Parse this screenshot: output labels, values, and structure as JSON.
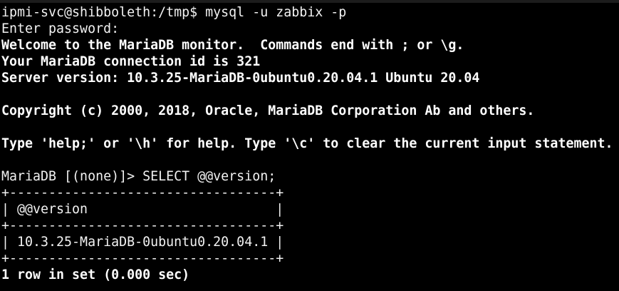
{
  "terminal": {
    "lines": [
      {
        "text": "ipmi-svc@shibboleth:/tmp$ mysql -u zabbix -p",
        "weight": "normal"
      },
      {
        "text": "Enter password:",
        "weight": "normal"
      },
      {
        "text": "Welcome to the MariaDB monitor.  Commands end with ; or \\g.",
        "weight": "bold"
      },
      {
        "text": "Your MariaDB connection id is 321",
        "weight": "bold"
      },
      {
        "text": "Server version: 10.3.25-MariaDB-0ubuntu0.20.04.1 Ubuntu 20.04",
        "weight": "bold"
      },
      {
        "text": "",
        "weight": "normal"
      },
      {
        "text": "Copyright (c) 2000, 2018, Oracle, MariaDB Corporation Ab and others.",
        "weight": "bold"
      },
      {
        "text": "",
        "weight": "normal"
      },
      {
        "text": "Type 'help;' or '\\h' for help. Type '\\c' to clear the current input statement.",
        "weight": "bold"
      },
      {
        "text": "",
        "weight": "normal"
      },
      {
        "text": "MariaDB [(none)]> SELECT @@version;",
        "weight": "normal"
      },
      {
        "text": "+----------------------------------+",
        "weight": "normal"
      },
      {
        "text": "| @@version                        |",
        "weight": "normal"
      },
      {
        "text": "+----------------------------------+",
        "weight": "normal"
      },
      {
        "text": "| 10.3.25-MariaDB-0ubuntu0.20.04.1 |",
        "weight": "normal"
      },
      {
        "text": "+----------------------------------+",
        "weight": "normal"
      },
      {
        "text": "1 row in set (0.000 sec)",
        "weight": "bold"
      }
    ]
  }
}
